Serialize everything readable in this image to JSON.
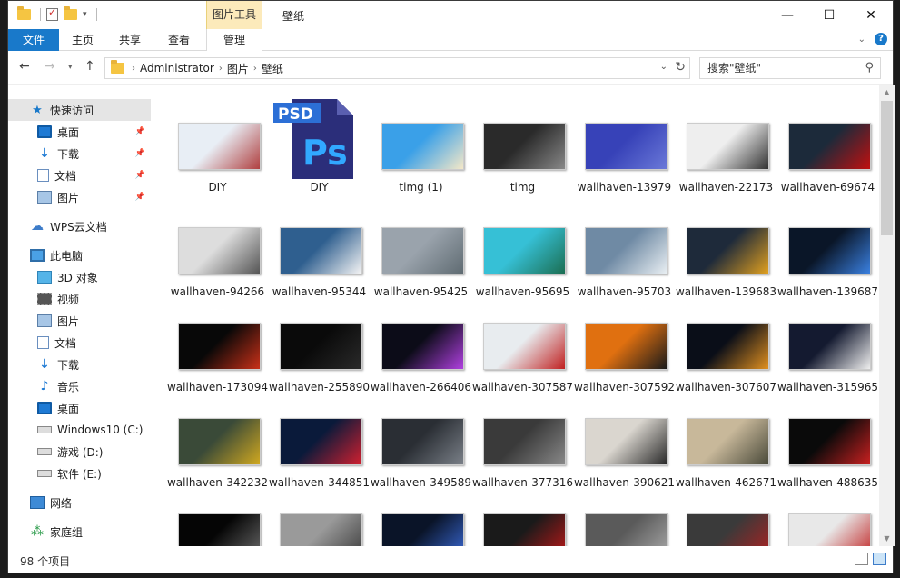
{
  "title_bar": {
    "tools_tab": "图片工具",
    "title": "壁纸",
    "minimize": "—",
    "maximize": "☐",
    "close": "✕"
  },
  "ribbon": {
    "tabs": [
      "文件",
      "主页",
      "共享",
      "查看",
      "管理"
    ],
    "help": "?"
  },
  "address": {
    "crumbs": [
      "Administrator",
      "图片",
      "壁纸"
    ],
    "search_placeholder": "搜索\"壁纸\""
  },
  "nav": {
    "quick_access": "快速访问",
    "quick_items": [
      "桌面",
      "下载",
      "文档",
      "图片"
    ],
    "wps": "WPS云文档",
    "this_pc": "此电脑",
    "pc_items": [
      "3D 对象",
      "视频",
      "图片",
      "文档",
      "下载",
      "音乐",
      "桌面",
      "Windows10 (C:)",
      "游戏 (D:)",
      "软件 (E:)"
    ],
    "network": "网络",
    "homegroup": "家庭组"
  },
  "files": [
    {
      "name": "DIY",
      "colors": [
        "#e8eef5",
        "#b04040"
      ]
    },
    {
      "name": "DIY",
      "colors": [
        "#2b2e7a",
        "#2b2e7a"
      ],
      "psd": true
    },
    {
      "name": "timg (1)",
      "colors": [
        "#3aa0e8",
        "#f4e8c8"
      ]
    },
    {
      "name": "timg",
      "colors": [
        "#2a2a2a",
        "#888888"
      ]
    },
    {
      "name": "wallhaven-13979",
      "colors": [
        "#3742b8",
        "#6a78d8"
      ]
    },
    {
      "name": "wallhaven-22173",
      "colors": [
        "#eeeeee",
        "#333333"
      ]
    },
    {
      "name": "wallhaven-69674",
      "colors": [
        "#1c2a3a",
        "#c01010"
      ]
    },
    {
      "name": "wallhaven-94266",
      "colors": [
        "#dddddd",
        "#555555"
      ]
    },
    {
      "name": "wallhaven-95344",
      "colors": [
        "#2f5f8f",
        "#f4f4f4"
      ]
    },
    {
      "name": "wallhaven-95425",
      "colors": [
        "#9aa3ac",
        "#5f6b72"
      ]
    },
    {
      "name": "wallhaven-95695",
      "colors": [
        "#36c0d6",
        "#1b6e52"
      ]
    },
    {
      "name": "wallhaven-95703",
      "colors": [
        "#6f8aa4",
        "#e8eef2"
      ]
    },
    {
      "name": "wallhaven-139683",
      "colors": [
        "#1e2a3a",
        "#e0a020"
      ]
    },
    {
      "name": "wallhaven-139687",
      "colors": [
        "#0a1628",
        "#3a80e0"
      ]
    },
    {
      "name": "wallhaven-173094",
      "colors": [
        "#080808",
        "#c83018"
      ]
    },
    {
      "name": "wallhaven-255890",
      "colors": [
        "#0a0a0a",
        "#2a2a2a"
      ]
    },
    {
      "name": "wallhaven-266406",
      "colors": [
        "#0c0c18",
        "#b040e0"
      ]
    },
    {
      "name": "wallhaven-307587",
      "colors": [
        "#e8ecef",
        "#c02020"
      ]
    },
    {
      "name": "wallhaven-307592",
      "colors": [
        "#e07010",
        "#1a1a1a"
      ]
    },
    {
      "name": "wallhaven-307607",
      "colors": [
        "#0a0e18",
        "#e09020"
      ]
    },
    {
      "name": "wallhaven-315965",
      "colors": [
        "#141a30",
        "#eeeeee"
      ]
    },
    {
      "name": "wallhaven-342232",
      "colors": [
        "#3a4a38",
        "#d0a820"
      ]
    },
    {
      "name": "wallhaven-344851",
      "colors": [
        "#0a1a3a",
        "#d02030"
      ]
    },
    {
      "name": "wallhaven-349589",
      "colors": [
        "#2a2e34",
        "#7a8088"
      ]
    },
    {
      "name": "wallhaven-377316",
      "colors": [
        "#3a3a3a",
        "#888888"
      ]
    },
    {
      "name": "wallhaven-390621",
      "colors": [
        "#dad6cf",
        "#2a2a2a"
      ]
    },
    {
      "name": "wallhaven-462671",
      "colors": [
        "#c8b89a",
        "#4a4a3a"
      ]
    },
    {
      "name": "wallhaven-488635",
      "colors": [
        "#0a0a0a",
        "#c82020"
      ]
    },
    {
      "name": "",
      "colors": [
        "#050505",
        "#6a6a6a"
      ]
    },
    {
      "name": "",
      "colors": [
        "#9a9a9a",
        "#3a3a3a"
      ]
    },
    {
      "name": "",
      "colors": [
        "#0a1428",
        "#3a6ad8"
      ]
    },
    {
      "name": "",
      "colors": [
        "#1a1a1a",
        "#c01818"
      ]
    },
    {
      "name": "",
      "colors": [
        "#5a5a5a",
        "#aaaaaa"
      ]
    },
    {
      "name": "",
      "colors": [
        "#3a3a3a",
        "#b02020"
      ]
    },
    {
      "name": "",
      "colors": [
        "#e8e8e8",
        "#c02020"
      ]
    }
  ],
  "status": {
    "count": "98 个项目"
  },
  "colors": {
    "accent": "#1979ca",
    "tools_tab_bg": "#fceabb"
  }
}
